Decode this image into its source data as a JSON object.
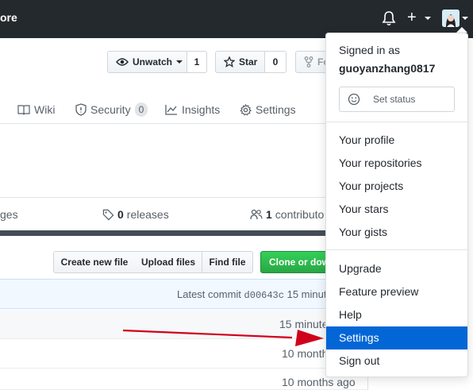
{
  "header": {
    "brand_fragment": "ore",
    "icons": {
      "notifications": "bell-icon",
      "create": "plus-icon",
      "avatar": "avatar-image"
    }
  },
  "repo_actions": {
    "unwatch_label": "Unwatch",
    "watch_count": "1",
    "star_label": "Star",
    "star_count": "0",
    "fork_label": "Fo"
  },
  "tabs": [
    {
      "label": "Wiki",
      "icon": "book-icon"
    },
    {
      "label": "Security",
      "icon": "shield-icon",
      "count": "0"
    },
    {
      "label": "Insights",
      "icon": "graph-icon"
    },
    {
      "label": "Settings",
      "icon": "gear-icon"
    }
  ],
  "stats": {
    "packages_fragment": "ges",
    "releases_count": "0",
    "releases_label": "releases",
    "contributors_count": "1",
    "contributors_label": "contributo"
  },
  "file_actions": {
    "create_label": "Create new file",
    "upload_label": "Upload files",
    "find_label": "Find file",
    "clone_label": "Clone or dow"
  },
  "commit": {
    "label": "Latest commit",
    "sha": "d00643c",
    "time": "15 minute"
  },
  "rows": [
    {
      "time": "15 minute"
    },
    {
      "time": "10 month"
    },
    {
      "time": "10 month"
    },
    {
      "time": "10 months ago"
    }
  ],
  "dropdown": {
    "signed_in_as": "Signed in as",
    "username": "guoyanzhang0817",
    "set_status": "Set status",
    "group1": [
      "Your profile",
      "Your repositories",
      "Your projects",
      "Your stars",
      "Your gists"
    ],
    "group2": [
      "Upgrade",
      "Feature preview",
      "Help",
      "Settings",
      "Sign out"
    ],
    "active_item": "Settings"
  },
  "colors": {
    "header_bg": "#24292e",
    "accent": "#0366d6",
    "arrow": "#d0021b",
    "clone_green": "#28a745"
  }
}
